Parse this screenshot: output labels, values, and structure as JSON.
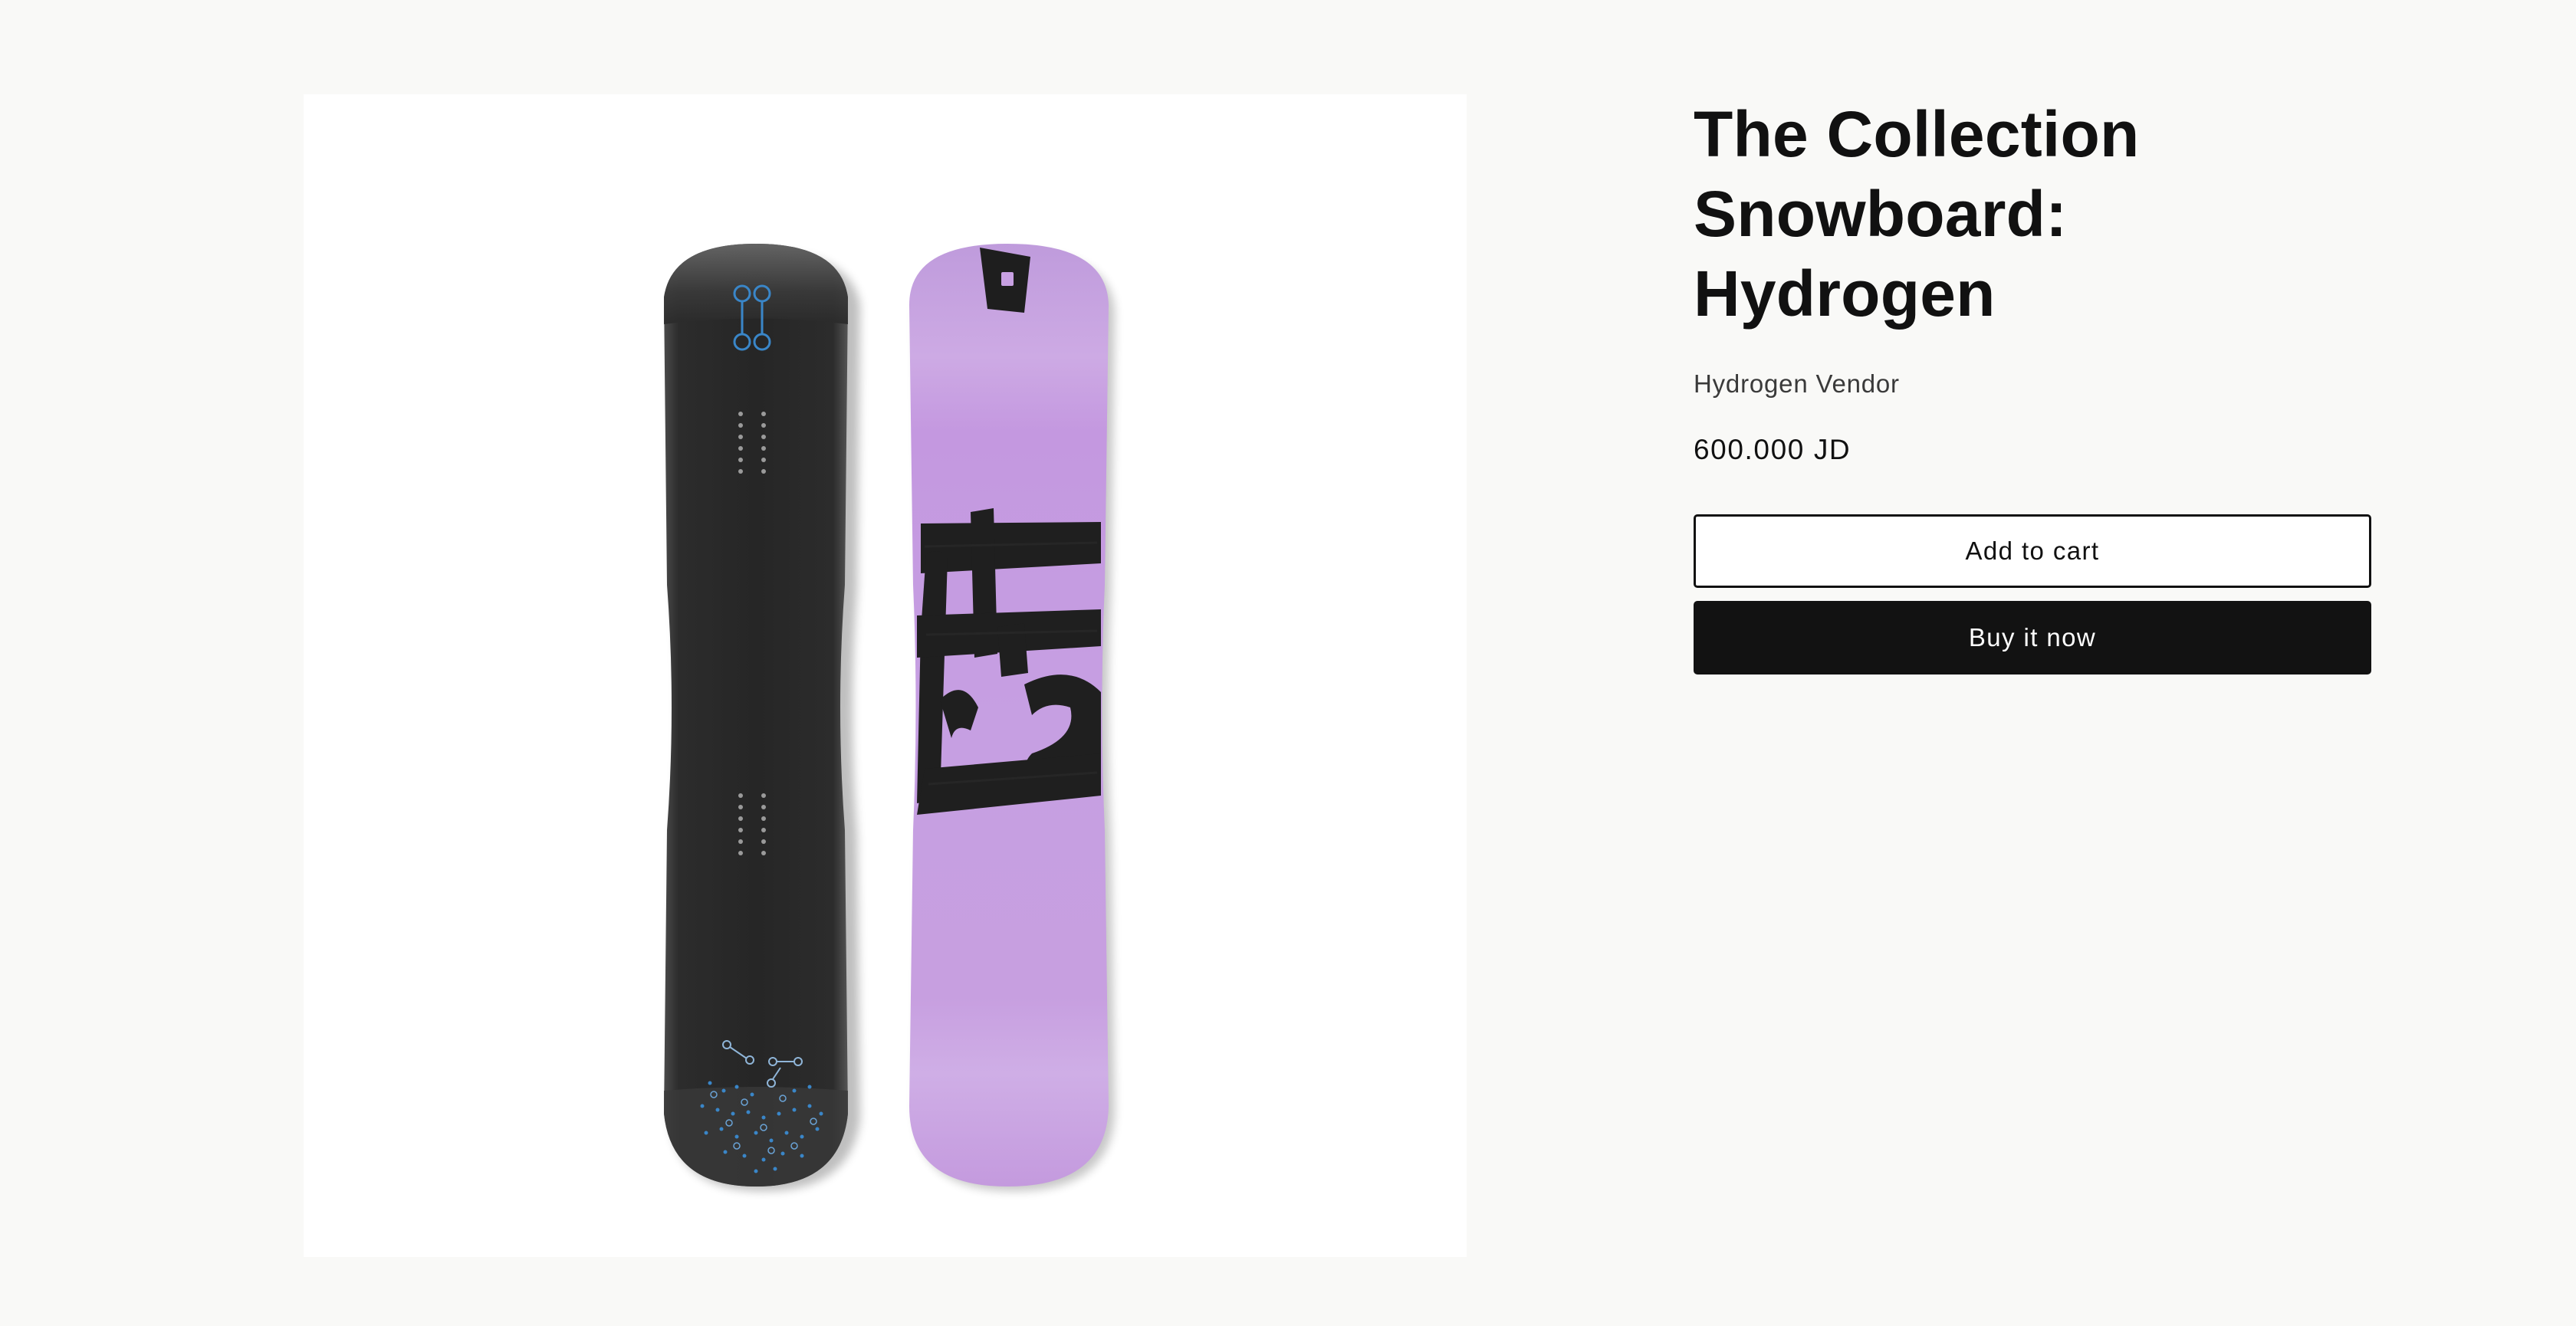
{
  "product": {
    "title": "The Collection Snowboard: Hydrogen",
    "vendor": "Hydrogen Vendor",
    "price": "600.000 JD",
    "add_to_cart_label": "Add to cart",
    "buy_now_label": "Buy it now"
  },
  "image": {
    "subject": "two snowboards: black base with blue graphics and lilac top with black brushstroke lettering"
  },
  "colors": {
    "page_background": "#f9f9f7",
    "board_dark": "#2a2a2a",
    "board_lilac": "#c8a0e2",
    "accent_blue": "#3a86c8",
    "buy_button": "#121212"
  }
}
